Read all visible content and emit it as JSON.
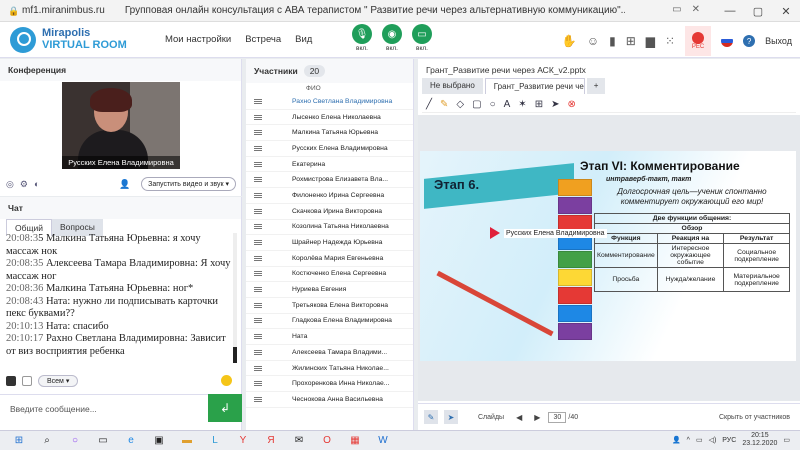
{
  "browser": {
    "url": "mf1.miranimbus.ru",
    "title": "Групповая онлайн консультация с АВА терапистом \" Развитие речи через альтернативную коммуникацию\"...."
  },
  "header": {
    "logo_line1": "Mirapolis",
    "logo_line2": "VIRTUAL ROOM",
    "nav": [
      "Мои настройки",
      "Встреча",
      "Вид"
    ],
    "ctrl_labels": [
      "вкл.",
      "вкл.",
      "вкл."
    ],
    "rec_label": "РЕС",
    "exit_label": "Выход",
    "help_glyph": "?"
  },
  "conference": {
    "title": "Конференция",
    "video_name": "Русских Елена Владимировна",
    "video_button": "Запустить видео и звук"
  },
  "chat": {
    "title": "Чат",
    "tabs": [
      "Общий",
      "Вопросы"
    ],
    "messages": [
      {
        "time": "20:08:3",
        "text": "5 Малкина Татьяна Юрьевна: я хочу массаж нок"
      },
      {
        "time": "20:08:35",
        "text": " Алексеева Тамара Владимировна: Я хочу массаж ног"
      },
      {
        "time": "20:08:36",
        "text": " Малкина Татьяна Юрьевна: ног*"
      },
      {
        "time": "20:08:43",
        "text": " Ната: нужно ли подписывать карточки пекс буквами??"
      },
      {
        "time": "20:10:13",
        "text": " Ната: спасибо"
      },
      {
        "time": "20:10:17",
        "text": " Рахно Светлана Владимировна: Зависит от виз восприятия ребенка"
      }
    ],
    "audience": "Всем",
    "placeholder": "Введите сообщение...",
    "send_glyph": "↲"
  },
  "participants": {
    "title": "Участники",
    "count": "20",
    "column": "ФИО",
    "list": [
      "Рахно Светлана Владимировна",
      "Лысенко Елена Николаевна",
      "Малкина Татьяна Юрьевна",
      "Русских Елена Владимировна",
      "Екатерина",
      "Рохмистрова Елизавета Вла...",
      "Филоненко Ирина Сергеевна",
      "Скачкова Ирина Викторовна",
      "Козолина Татьяна Николаевна",
      "Шрайнер Надежда Юрьевна",
      "Королёва Мария Евгеньевна",
      "Костюченко Елена Сергеевна",
      "Нуриева Евгения",
      "Третьякова Елена Викторовна",
      "Гладкова Елена Владимировна",
      "Ната",
      "Алексеева Тамара Владими...",
      "Жилинских Татьяна Николае...",
      "Прохоренкова Инна Николае...",
      "Чеснокова Анна Васильевна"
    ]
  },
  "presentation": {
    "title": "Грант_Развитие речи через АСК_v2.pptx",
    "tabs": [
      "Не выбрано",
      "Грант_Развитие речи через ...",
      "+"
    ],
    "slide": {
      "stage": "Этап 6.",
      "heading": "Этап VI:  Комментирование",
      "subheading": "интраверб-такт, такт",
      "goal": "Долгосрочная цель—ученик спонтанно комментирует окружающий его мир!",
      "table_title": "Две функции общения:",
      "table_subtitle": "Обзор",
      "table_headers": [
        "Функция",
        "Реакция на",
        "Результат"
      ],
      "table_rows": [
        [
          "Комментирование",
          "Интересное окружающее событие",
          "Социальное подкрепление"
        ],
        [
          "Просьба",
          "Нужда/желание",
          "Материальное подкрепление"
        ]
      ],
      "pointer_name": "Русских Елена Владимировна"
    },
    "slides_label": "Слайды",
    "current_slide": "30",
    "total_slides": "/40",
    "hide_label": "Скрыть от участников"
  },
  "taskbar": {
    "lang": "РУС",
    "time": "20:15",
    "date": "23.12.2020"
  },
  "colors": {
    "accent": "#2e6fb0",
    "green": "#1f9e5a",
    "send": "#2aa14a",
    "record": "#e53935"
  }
}
